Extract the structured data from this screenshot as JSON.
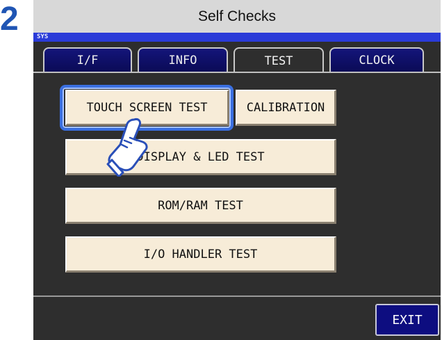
{
  "step_number": "2",
  "title": "Self Checks",
  "sys_label": "SYS",
  "tabs": [
    {
      "label": "I/F",
      "active": false
    },
    {
      "label": "INFO",
      "active": false
    },
    {
      "label": "TEST",
      "active": true
    },
    {
      "label": "CLOCK",
      "active": false
    }
  ],
  "buttons": {
    "touch_screen_test": "TOUCH SCREEN TEST",
    "calibration": "CALIBRATION",
    "display_led_test": "DISPLAY & LED TEST",
    "rom_ram_test": "ROM/RAM TEST",
    "io_handler_test": "I/O HANDLER TEST",
    "exit": "EXIT"
  },
  "colors": {
    "step_number": "#1f55b4",
    "sys_bar": "#2a3bd8",
    "tab": "#14157a",
    "button_face": "#f7ecd8",
    "highlight": "#3a6fe0",
    "exit_button": "#0d0d80"
  },
  "icons": {
    "pointer": "pointing-hand-icon"
  }
}
